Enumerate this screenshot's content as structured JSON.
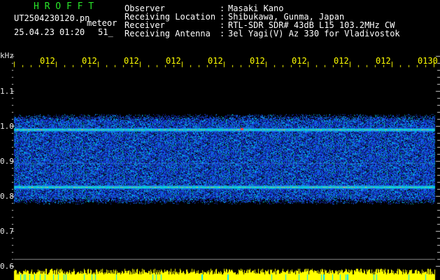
{
  "header": {
    "brand": "H R O F F T",
    "filename": "UT2504230120.pn",
    "mode": "meteor",
    "date": "25.04.23 01:20",
    "count": "51_",
    "info": [
      {
        "label": "Observer",
        "sep": ":",
        "value": "Masaki Kano"
      },
      {
        "label": "Receiving Location",
        "sep": ":",
        "value": "Shibukawa, Gunma, Japan"
      },
      {
        "label": "Receiver",
        "sep": ":",
        "value": "RTL-SDR SDR# 43dB L15 103.2MHz CW"
      },
      {
        "label": "Receiving Antenna",
        "sep": ":",
        "value": "3el Yagi(V) Az 330 for Vladivostok"
      }
    ]
  },
  "axis": {
    "unit": "kHz",
    "y_ticks": [
      "1.1",
      "1.0",
      "0.9",
      "0.8",
      "0.7",
      "0.6"
    ],
    "x_ticks": [
      "012",
      "012",
      "012",
      "012",
      "012",
      "012",
      "012",
      "012",
      "012",
      "0130"
    ]
  },
  "colors": {
    "background": "#000000",
    "noise_blue": "#1a2fd4",
    "signal_line": "#00ffc8",
    "brand_green": "#29e629",
    "tick_yellow": "#ffff00"
  }
}
